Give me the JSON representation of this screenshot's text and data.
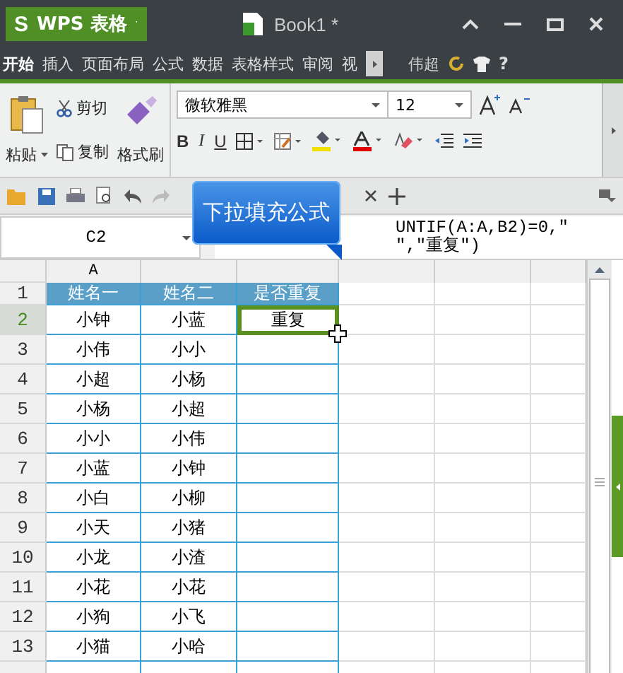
{
  "app": {
    "logo": "S",
    "name": "WPS 表格"
  },
  "document": {
    "title": "Book1 *"
  },
  "menu": [
    {
      "label": "开始",
      "selected": true
    },
    {
      "label": "插入",
      "selected": false
    },
    {
      "label": "页面布局",
      "selected": false
    },
    {
      "label": "公式",
      "selected": false
    },
    {
      "label": "数据",
      "selected": false
    },
    {
      "label": "表格样式",
      "selected": false
    },
    {
      "label": "审阅",
      "selected": false
    },
    {
      "label": "视",
      "selected": false
    }
  ],
  "user": {
    "name": "伟超"
  },
  "help": "?",
  "clipboard": {
    "paste": "粘贴",
    "cut": "剪切",
    "copy": "复制",
    "format_painter": "格式刷"
  },
  "font": {
    "name": "微软雅黑",
    "size": "12",
    "bold": "B",
    "italic": "I",
    "underline": "U"
  },
  "formula_bar": {
    "cell_ref": "C2",
    "formula_line_1": "UNTIF(A:A,B2)=0,\"",
    "formula_line_2": "\",\"重复\")"
  },
  "callout": "下拉填充公式",
  "columns": [
    "A"
  ],
  "rows": [
    {
      "number": "1",
      "cells": [
        "姓名一",
        "姓名二",
        "是否重复"
      ],
      "kind": "header",
      "selected": false
    },
    {
      "number": "2",
      "cells": [
        "小钟",
        "小蓝",
        "重复"
      ],
      "kind": "data",
      "selected": true
    },
    {
      "number": "3",
      "cells": [
        "小伟",
        "小小",
        ""
      ],
      "kind": "data",
      "selected": false
    },
    {
      "number": "4",
      "cells": [
        "小超",
        "小杨",
        ""
      ],
      "kind": "data",
      "selected": false
    },
    {
      "number": "5",
      "cells": [
        "小杨",
        "小超",
        ""
      ],
      "kind": "data",
      "selected": false
    },
    {
      "number": "6",
      "cells": [
        "小小",
        "小伟",
        ""
      ],
      "kind": "data",
      "selected": false
    },
    {
      "number": "7",
      "cells": [
        "小蓝",
        "小钟",
        ""
      ],
      "kind": "data",
      "selected": false
    },
    {
      "number": "8",
      "cells": [
        "小白",
        "小柳",
        ""
      ],
      "kind": "data",
      "selected": false
    },
    {
      "number": "9",
      "cells": [
        "小天",
        "小猪",
        ""
      ],
      "kind": "data",
      "selected": false
    },
    {
      "number": "10",
      "cells": [
        "小龙",
        "小渣",
        ""
      ],
      "kind": "data",
      "selected": false
    },
    {
      "number": "11",
      "cells": [
        "小花",
        "小花",
        ""
      ],
      "kind": "data",
      "selected": false
    },
    {
      "number": "12",
      "cells": [
        "小狗",
        "小飞",
        ""
      ],
      "kind": "data",
      "selected": false
    },
    {
      "number": "13",
      "cells": [
        "小猫",
        "小哈",
        ""
      ],
      "kind": "data",
      "selected": false
    }
  ]
}
